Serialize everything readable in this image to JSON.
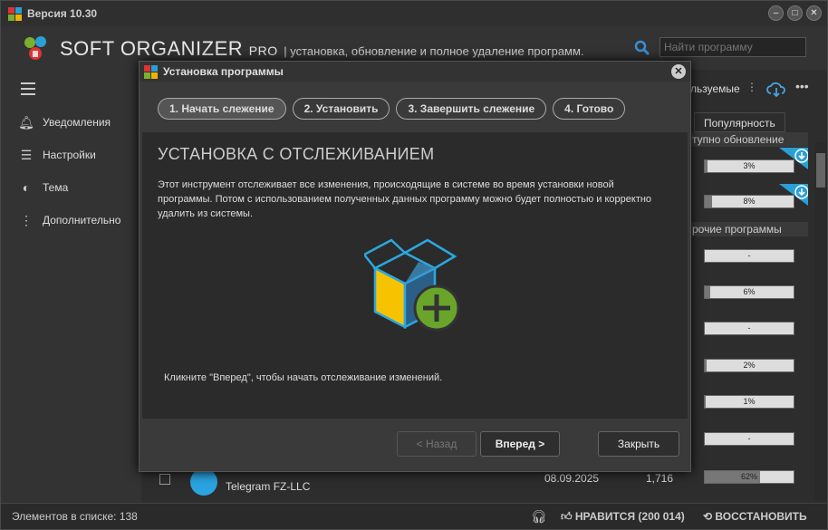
{
  "window": {
    "version": "Версия 10.30"
  },
  "header": {
    "brand": "SOFT ORGANIZER",
    "pro": "PRO",
    "subtitle": "| установка, обновление и полное удаление программ.",
    "search_placeholder": "Найти программу"
  },
  "sidebar": {
    "items": [
      {
        "label": "Уведомления",
        "icon": "bell-icon"
      },
      {
        "label": "Настройки",
        "icon": "sliders-icon"
      },
      {
        "label": "Тема",
        "icon": "theme-icon"
      },
      {
        "label": "Дополнительно",
        "icon": "more-vertical-icon"
      }
    ]
  },
  "list": {
    "top_hint": "льзуемые",
    "col_popularity": "Популярность",
    "groups": [
      "тупно обновление",
      "рочие программы"
    ],
    "bars": [
      {
        "label": "3%",
        "value": 3
      },
      {
        "label": "8%",
        "value": 8
      },
      {
        "label": "-",
        "value": 0
      },
      {
        "label": "6%",
        "value": 6
      },
      {
        "label": "-",
        "value": 0
      },
      {
        "label": "2%",
        "value": 2
      },
      {
        "label": "1%",
        "value": 1
      },
      {
        "label": "-",
        "value": 0
      },
      {
        "label": "62%",
        "value": 62
      }
    ],
    "bottom_row": {
      "publisher": "Telegram FZ-LLC",
      "date": "08.09.2025",
      "size": "1,716"
    }
  },
  "status": {
    "count": "Элементов в списке: 138",
    "like": "НРАВИТСЯ (200 014)",
    "restore": "ВОССТАНОВИТЬ"
  },
  "dialog": {
    "title": "Установка программы",
    "steps": [
      "1. Начать слежение",
      "2. Установить",
      "3. Завершить слежение",
      "4. Готово"
    ],
    "heading": "УСТАНОВКА С ОТСЛЕЖИВАНИЕМ",
    "text": "Этот инструмент отслеживает все изменения, происходящие в системе во время установки новой программы. Потом с использованием полученных данных программу можно будет полностью и корректно удалить из системы.",
    "hint": "Кликните \"Вперед\", чтобы начать отслеживание изменений.",
    "buttons": {
      "back": "< Назад",
      "next": "Вперед >",
      "close": "Закрыть"
    }
  }
}
